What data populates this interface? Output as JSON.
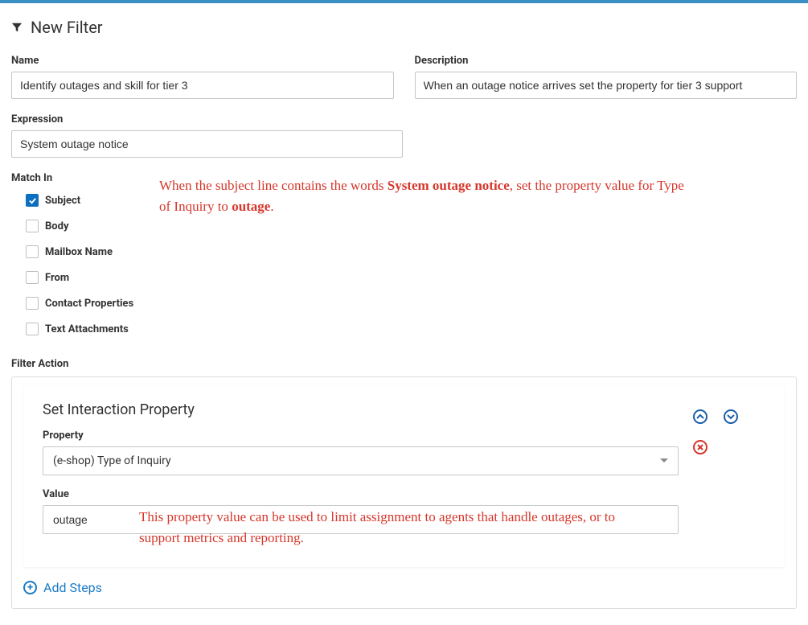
{
  "header": {
    "title": "New Filter"
  },
  "fields": {
    "name_label": "Name",
    "name_value": "Identify outages and skill for tier 3",
    "description_label": "Description",
    "description_value": "When an outage notice arrives set the property for tier 3 support",
    "expression_label": "Expression",
    "expression_value": "System outage notice"
  },
  "match_in": {
    "label": "Match In",
    "options": [
      "Subject",
      "Body",
      "Mailbox Name",
      "From",
      "Contact Properties",
      "Text Attachments"
    ],
    "checked": [
      true,
      false,
      false,
      false,
      false,
      false
    ]
  },
  "annotations": {
    "top_prefix": "When the subject line contains the words ",
    "top_bold1": "System outage notice",
    "top_mid": ", set the property value for Type of Inquiry to ",
    "top_bold2": "outage",
    "top_suffix": ".",
    "bottom": "This property value can be used to limit assignment to agents that handle outages, or to support metrics and reporting."
  },
  "filter_action": {
    "section_label": "Filter Action",
    "step_title": "Set Interaction Property",
    "property_label": "Property",
    "property_value": "(e-shop) Type of Inquiry",
    "value_label": "Value",
    "value_value": "outage",
    "add_steps_label": "Add Steps"
  }
}
